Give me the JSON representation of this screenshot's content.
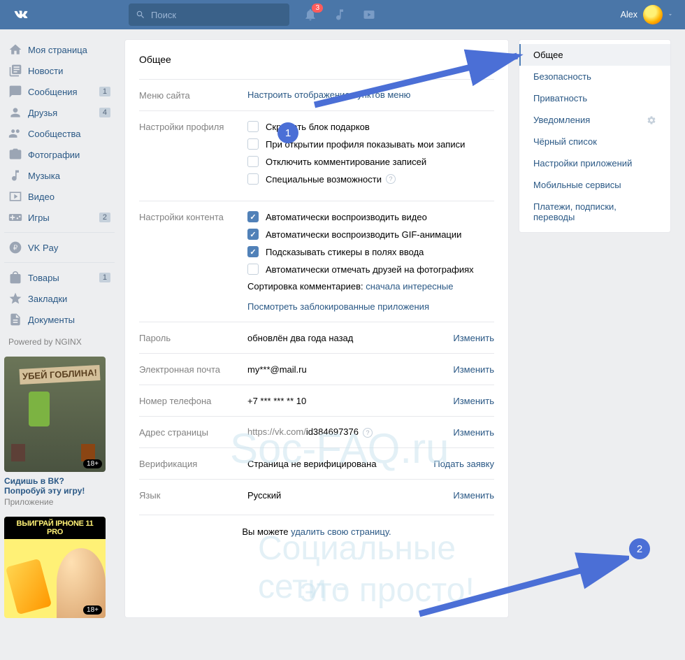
{
  "header": {
    "search_placeholder": "Поиск",
    "notification_badge": "3",
    "username": "Alex"
  },
  "sidebar": {
    "items": [
      {
        "label": "Моя страница",
        "icon": "home"
      },
      {
        "label": "Новости",
        "icon": "news"
      },
      {
        "label": "Сообщения",
        "icon": "messages",
        "count": "1"
      },
      {
        "label": "Друзья",
        "icon": "friends",
        "count": "4"
      },
      {
        "label": "Сообщества",
        "icon": "groups"
      },
      {
        "label": "Фотографии",
        "icon": "photos"
      },
      {
        "label": "Музыка",
        "icon": "music"
      },
      {
        "label": "Видео",
        "icon": "video"
      },
      {
        "label": "Игры",
        "icon": "games",
        "count": "2"
      }
    ],
    "items2": [
      {
        "label": "VK Pay",
        "icon": "pay"
      }
    ],
    "items3": [
      {
        "label": "Товары",
        "icon": "market",
        "count": "1"
      },
      {
        "label": "Закладки",
        "icon": "bookmarks"
      },
      {
        "label": "Документы",
        "icon": "docs"
      }
    ],
    "powered": "Powered by NGINX",
    "ad1": {
      "title": "Сидишь в ВК? Попробуй эту игру!",
      "sub": "Приложение",
      "age": "18+",
      "banner": "УБЕЙ ГОБЛИНА!"
    },
    "ad2": {
      "head": "ВЫИГРАЙ IPHONE 11 PRO",
      "age": "18+"
    }
  },
  "settings": {
    "title": "Общее",
    "menu": {
      "label": "Меню сайта",
      "action": "Настроить отображение пунктов меню"
    },
    "profile": {
      "label": "Настройки профиля",
      "opts": [
        {
          "text": "Скрывать блок подарков",
          "checked": false
        },
        {
          "text": "При открытии профиля показывать мои записи",
          "checked": false
        },
        {
          "text": "Отключить комментирование записей",
          "checked": false
        },
        {
          "text": "Специальные возможности",
          "checked": false,
          "help": true
        }
      ]
    },
    "content": {
      "label": "Настройки контента",
      "opts": [
        {
          "text": "Автоматически воспроизводить видео",
          "checked": true
        },
        {
          "text": "Автоматически воспроизводить GIF-анимации",
          "checked": true
        },
        {
          "text": "Подсказывать стикеры в полях ввода",
          "checked": true
        },
        {
          "text": "Автоматически отмечать друзей на фотографиях",
          "checked": false
        }
      ],
      "sort_label": "Сортировка комментариев: ",
      "sort_value": "сначала интересные",
      "blocked": "Посмотреть заблокированные приложения"
    },
    "password": {
      "label": "Пароль",
      "value": "обновлён два года назад",
      "action": "Изменить"
    },
    "email": {
      "label": "Электронная почта",
      "value": "my***@mail.ru",
      "action": "Изменить"
    },
    "phone": {
      "label": "Номер телефона",
      "value": "+7 *** *** ** 10",
      "action": "Изменить"
    },
    "address": {
      "label": "Адрес страницы",
      "prefix": "https://vk.com/",
      "value": "id384697376",
      "action": "Изменить"
    },
    "verification": {
      "label": "Верификация",
      "value": "Страница не верифицирована",
      "action": "Подать заявку"
    },
    "language": {
      "label": "Язык",
      "value": "Русский",
      "action": "Изменить"
    },
    "footer": {
      "prefix": "Вы можете ",
      "link": "удалить свою страницу."
    }
  },
  "rightnav": {
    "items": [
      {
        "label": "Общее",
        "active": true
      },
      {
        "label": "Безопасность"
      },
      {
        "label": "Приватность"
      },
      {
        "label": "Уведомления",
        "gear": true
      },
      {
        "label": "Чёрный список"
      },
      {
        "label": "Настройки приложений"
      },
      {
        "label": "Мобильные сервисы"
      },
      {
        "label": "Платежи, подписки, переводы"
      }
    ]
  },
  "annotations": {
    "n1": "1",
    "n2": "2"
  },
  "watermark": {
    "l1": "Soc-FAQ.ru",
    "l2": "Социальные сети -",
    "l3": "это просто!"
  }
}
